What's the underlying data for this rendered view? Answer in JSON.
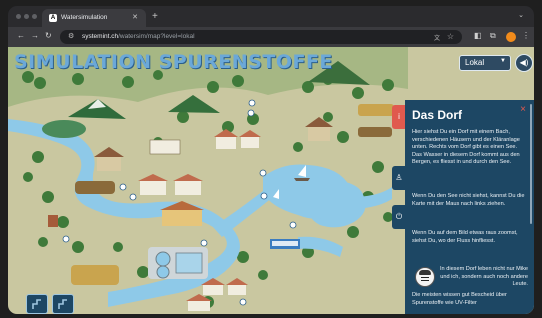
{
  "browser": {
    "tab_title": "Watersimulation",
    "tab_favicon": "A",
    "url_host": "systemint.ch",
    "url_path": "/watersim/map?level=lokal",
    "new_tab": "+",
    "menu": "⋮"
  },
  "page": {
    "banner": "SIMULATION SPURENSTOFFE",
    "level_select": "Lokal",
    "sound_icon": "speaker-icon"
  },
  "panel": {
    "title": "Das Dorf",
    "close": "×",
    "p1": "Hier siehst Du ein Dorf mit einem Bach, verschiedenen Häusern und der Kläranlage unten. Rechts vom Dorf gibt es einen See. Das Wasser in diesem Dorf kommt aus den Bergen, es fliesst in und durch den See.",
    "p2": "Wenn Du den See nicht siehst, kannst Du die Karte mit der Maus nach links ziehen.",
    "p3": "Wenn Du auf dem Bild etwas raus zoomst, siehst Du, wo der Fluss hinfliesst.",
    "p4": "In diesem Dorf leben nicht nur Mike und ich, sondern auch noch andere Leute.",
    "p5": "Die meisten wissen gut Bescheid über Spurenstoffe wie UV-Filter"
  },
  "side_buttons": [
    {
      "icon": "info-icon",
      "label": "i",
      "color": "#e05a4e"
    },
    {
      "icon": "person-icon",
      "label": "♙",
      "color": "#1d4764"
    },
    {
      "icon": "power-icon",
      "label": "⏻",
      "color": "#1d4764"
    }
  ],
  "colors": {
    "panel": "#1d4764",
    "water": "#8ec9e8",
    "ground": "#c9c7a0",
    "accent": "#e05a4e"
  }
}
